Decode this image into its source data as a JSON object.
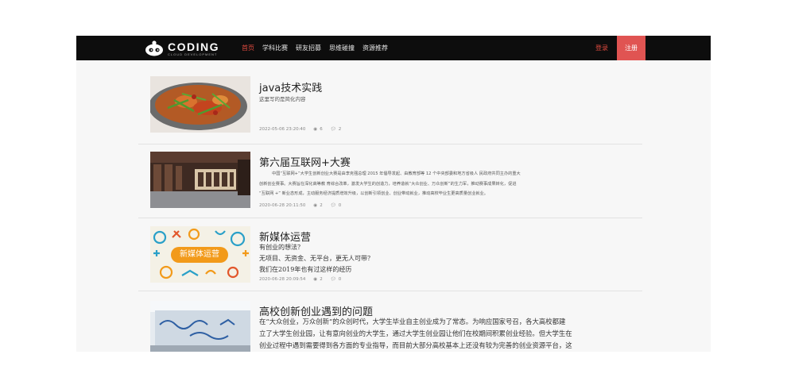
{
  "brand": {
    "name": "CODING",
    "subtitle": "CLOUD DEVELOPMENT"
  },
  "nav": {
    "links": [
      "首页",
      "学科比赛",
      "研友招募",
      "思维碰撞",
      "资源推荐"
    ],
    "active_index": 0,
    "login": "登录",
    "register": "注册"
  },
  "colors": {
    "accent": "#e04a3f",
    "nav_bg": "#0d0d0d",
    "register_bg": "#e05452"
  },
  "articles": [
    {
      "title": "java技术实践",
      "body": [
        "这里写的是简化内容"
      ],
      "date": "2022-05-06 23:20:40",
      "views": "6",
      "comments": "2",
      "thumb_icon": "food-dish-image"
    },
    {
      "title": "第六届互联网+大赛",
      "body": [
        "中国“互联网+”大学生创新创业大赛是由李克强总理 2015 年倡导发起、由教育部等 12 个中央部委和地方省级人 民政府共同主办的重大",
        "创新创业赛事。大赛旨在深化高等教 育综合改革，激发大学生的创造力，培养造就“大众创业、万众创新”的生力军，推动赛事成果转化，促进",
        "“互联网 +” 新业态形成，主动服务经济提质增效升级，以创新引领创业、创业带动就业，推动高校毕业生更高质量创业就业。"
      ],
      "date": "2020-06-28 20:11:50",
      "views": "2",
      "comments": "0",
      "thumb_icon": "library-image"
    },
    {
      "title": "新媒体运营",
      "body": [
        "有创业的想法？",
        "无项目、无资金、无平台，更无人可带？",
        "我们在2019年也有过这样的经历"
      ],
      "date": "2020-06-28 20:09:54",
      "views": "2",
      "comments": "0",
      "thumb_icon": "new-media-banner-image",
      "thumb_label": "新媒体运营"
    },
    {
      "title": "高校创新创业遇到的问题",
      "body": [
        "在“大众创业，万众创新”的众创时代，大学生毕业自主创业成为了常态。为响应国家号召，各大高校都建",
        "立了大学生创业园，让有意向创业的大学生，通过大学生创业园让他们在校期间积累创业经验。但大学生在",
        "创业过程中遇到需要得到各方面的专业指导，而目前大部分高校基本上还没有较为完善的创业资源平台，这"
      ],
      "thumb_icon": "campus-wall-image"
    }
  ]
}
